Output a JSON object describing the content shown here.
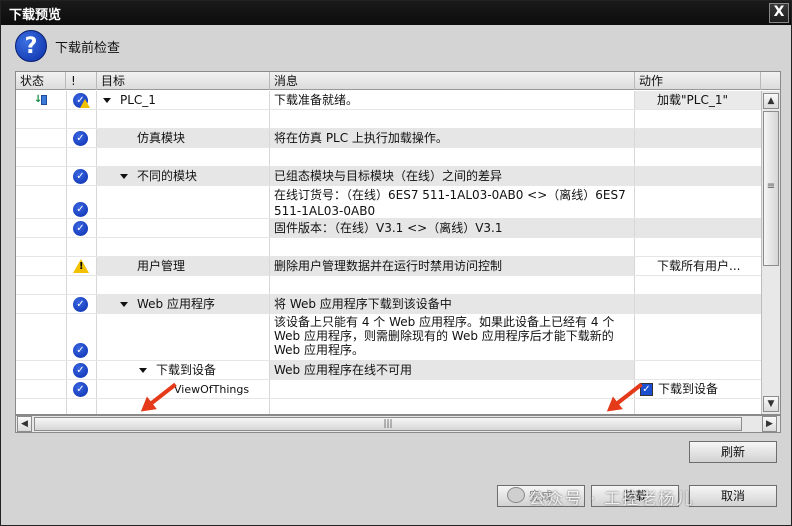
{
  "window": {
    "title": "下载预览",
    "close": "X"
  },
  "header": {
    "title": "下载前检查"
  },
  "columns": {
    "status": "状态",
    "excl": "!",
    "target": "目标",
    "message": "消息",
    "action": "动作"
  },
  "rows": [
    {
      "target": "PLC_1",
      "message": "下载准备就绪。",
      "action": "加载\"PLC_1\""
    },
    {
      "target": "仿真模块",
      "message": "将在仿真 PLC 上执行加载操作。"
    },
    {
      "target": "不同的模块",
      "message": "已组态模块与目标模块（在线）之间的差异"
    },
    {
      "message": "在线订货号：（在线）6ES7 511-1AL03-0AB0 <>（离线）6ES7 511-1AL03-0AB0"
    },
    {
      "message": "固件版本：（在线）V3.1 <>（离线）V3.1"
    },
    {
      "target": "用户管理",
      "message": "删除用户管理数据并在运行时禁用访问控制",
      "action": "下载所有用户..."
    },
    {
      "target": "Web 应用程序",
      "message": "将 Web 应用程序下载到该设备中"
    },
    {
      "message": "该设备上只能有 4 个 Web 应用程序。如果此设备上已经有 4 个 Web 应用程序，则需删除现有的 Web 应用程序后才能下载新的 Web 应用程序。"
    },
    {
      "target": "下载到设备",
      "message": "Web 应用程序在线不可用"
    },
    {
      "target": "ViewOfThings",
      "action": "下载到设备"
    }
  ],
  "buttons": {
    "refresh": "刷新",
    "finish": "完成",
    "load": "装载",
    "cancel": "取消"
  },
  "watermark": "公众号 · 工控老杨儿",
  "colors": {
    "accent": "#0a2fb0",
    "warning": "#f2c200",
    "arrow": "#e53a1a"
  }
}
